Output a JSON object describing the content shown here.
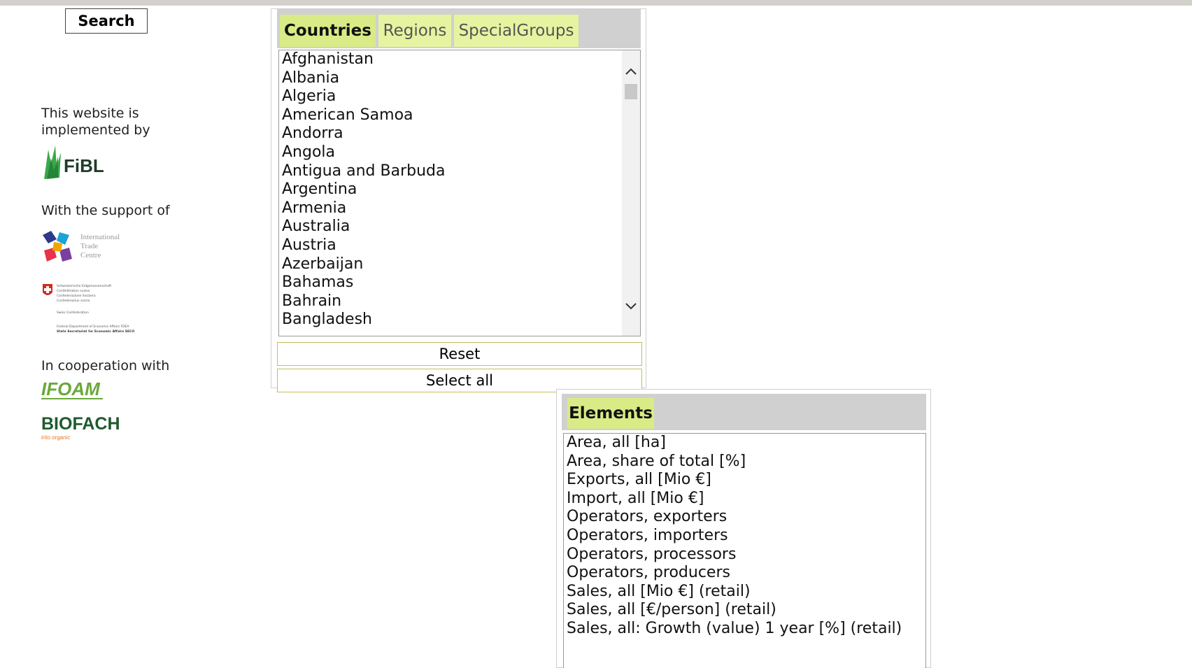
{
  "search": {
    "label": "Search"
  },
  "sidebar": {
    "implemented_by": "This website is implemented by",
    "support_of": "With the support of",
    "cooperation_with": "In cooperation with",
    "logos": {
      "fibl": "FiBL",
      "itc": [
        "International",
        "Trade",
        "Centre"
      ],
      "seco": [
        "Schweizerische Eidgenossenschaft",
        "Confédération suisse",
        "Confederazione Svizzera",
        "Confederaziun svizra",
        "Swiss Confederation",
        "Federal Department of Economic Affairs FDEA",
        "State Secretariat for Economic Affairs SECO"
      ],
      "ifoam": "IFOAM",
      "biofach": "BIOFACH",
      "biofach_tagline": "into organic"
    }
  },
  "countries_panel": {
    "tabs": [
      {
        "label": "Countries",
        "active": true
      },
      {
        "label": "Regions",
        "active": false
      },
      {
        "label": "SpecialGroups",
        "active": false
      }
    ],
    "items": [
      "Afghanistan",
      "Albania",
      "Algeria",
      "American Samoa",
      "Andorra",
      "Angola",
      "Antigua and Barbuda",
      "Argentina",
      "Armenia",
      "Australia",
      "Austria",
      "Azerbaijan",
      "Bahamas",
      "Bahrain",
      "Bangladesh"
    ],
    "reset_label": "Reset",
    "select_all_label": "Select all"
  },
  "elements_panel": {
    "tab_label": "Elements",
    "items": [
      "Area, all [ha]",
      "Area, share of total [%]",
      "Exports, all [Mio €]",
      "Import, all [Mio €]",
      "Operators, exporters",
      "Operators, importers",
      "Operators, processors",
      "Operators, producers",
      "Sales, all [Mio €] (retail)",
      "Sales, all [€/person] (retail)",
      "Sales, all: Growth (value) 1 year [%] (retail)"
    ]
  },
  "colors": {
    "tab_bg": "#e6f3a0",
    "tab_active_bg": "#d9eb86",
    "header_bg": "#d0d0d0",
    "button_border": "#c2bf5c",
    "fibl_green": "#2e8b3a",
    "biofach_green": "#1f5a2e",
    "biofach_orange": "#e87722"
  }
}
